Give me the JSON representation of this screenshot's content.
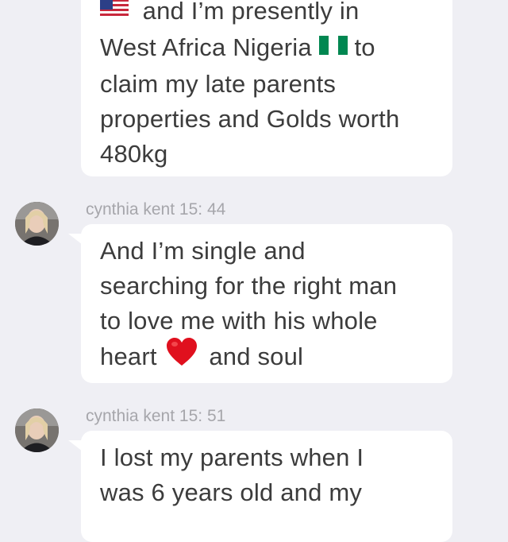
{
  "messages": [
    {
      "lines": {
        "l1_text": "and I’m presently in",
        "l2_text": "West Africa Nigeria",
        "l2_after": "to",
        "l3": "claim my late parents",
        "l4": "properties and Golds worth",
        "l5": "480kg"
      },
      "icons": [
        "us-flag-emoji",
        "nigeria-flag-emoji"
      ]
    },
    {
      "sender": "cynthia kent",
      "time": "15: 44",
      "lines": {
        "l1": "And I’m single and",
        "l2": "searching for the right man",
        "l3": "to love me with his whole",
        "l4_before": "heart",
        "l4_after": "and soul"
      },
      "icons": [
        "red-heart-emoji"
      ]
    },
    {
      "sender": "cynthia kent",
      "time": "15: 51",
      "lines": {
        "l1": "I lost my parents when I",
        "l2": "was 6 years old and my"
      }
    }
  ],
  "colors": {
    "background": "#efeff4",
    "bubble": "#ffffff",
    "message_text": "#3c3c3c",
    "meta_text": "#a6a6ab",
    "heart": "#e0101e",
    "nigeria_green": "#008751"
  }
}
